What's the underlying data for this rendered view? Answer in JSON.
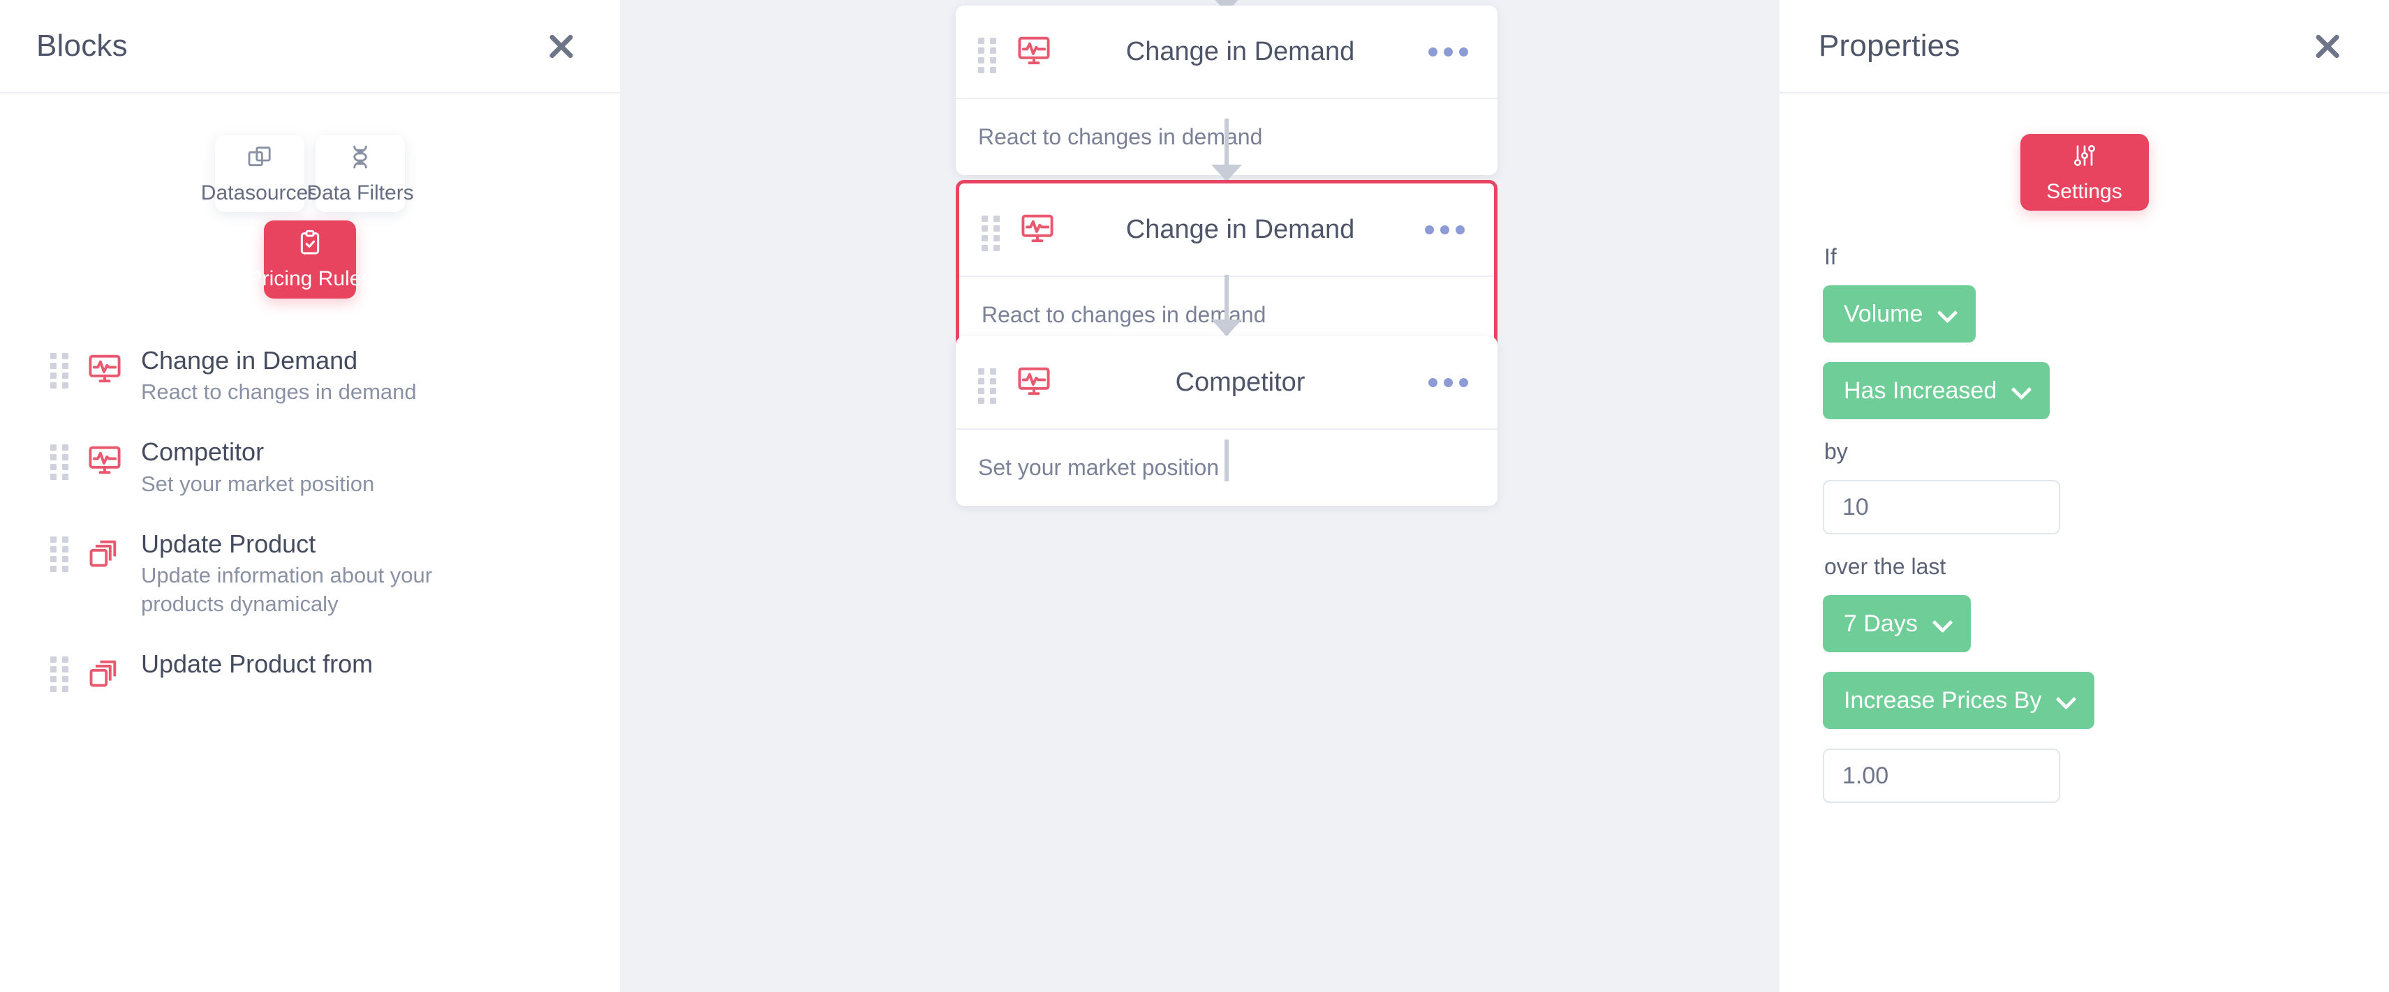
{
  "sidebar": {
    "title": "Blocks",
    "close_icon": "close-icon",
    "tiles": [
      {
        "label": "Datasources",
        "icon": "stacked-squares-icon",
        "active": false
      },
      {
        "label": "Data Filters",
        "icon": "dna-helix-icon",
        "active": false
      },
      {
        "label": "Pricing Rules",
        "icon": "clipboard-check-icon",
        "active": true
      }
    ],
    "blocks": [
      {
        "title": "Change in Demand",
        "subtitle": "React to changes in demand",
        "icon": "monitor-pulse-icon"
      },
      {
        "title": "Competitor",
        "subtitle": "Set your market position",
        "icon": "monitor-pulse-icon"
      },
      {
        "title": "Update Product",
        "subtitle": "Update information about your products dynamicaly",
        "icon": "stacked-cards-icon"
      },
      {
        "title": "Update Product from",
        "subtitle": "",
        "icon": "stacked-cards-icon"
      }
    ]
  },
  "canvas": {
    "nodes": [
      {
        "title": "Change in Demand",
        "description": "React to changes in demand",
        "icon": "monitor-pulse-icon",
        "menu_icon": "kebab-menu-icon",
        "selected": false
      },
      {
        "title": "Change in Demand",
        "description": "React to changes in demand",
        "icon": "monitor-pulse-icon",
        "menu_icon": "kebab-menu-icon",
        "selected": true
      },
      {
        "title": "Competitor",
        "description": "Set your market position",
        "icon": "monitor-pulse-icon",
        "menu_icon": "kebab-menu-icon",
        "selected": false
      }
    ]
  },
  "properties": {
    "title": "Properties",
    "close_icon": "close-icon",
    "settings_button": {
      "label": "Settings",
      "icon": "sliders-icon"
    },
    "labels": {
      "if": "If",
      "by": "by",
      "over_the_last": "over the last"
    },
    "fields": {
      "metric": "Volume",
      "condition": "Has Increased",
      "amount": "10",
      "period": "7 Days",
      "action": "Increase Prices By",
      "action_amount": "1.00"
    }
  },
  "colors": {
    "accent_pink": "#E8445F",
    "accent_green": "#6FCD98",
    "canvas_bg": "#F0F1F5",
    "text_dark": "#4E5569",
    "text_muted": "#8B91A4"
  }
}
